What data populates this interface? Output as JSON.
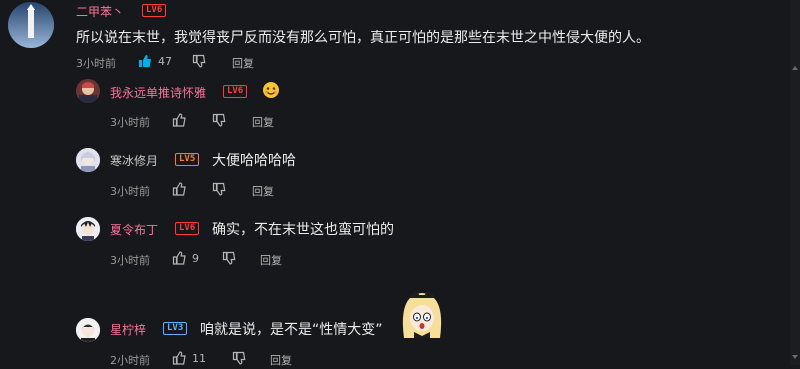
{
  "colors": {
    "background": "#17181c",
    "name_pink": "#fb7299",
    "name_gray": "#c9c9c9",
    "like_active": "#00aeec",
    "lv6": "#ff3b3b",
    "lv5": "#ff7a3a",
    "lv3": "#5fb0ff"
  },
  "main_comment": {
    "username": "二甲苯丶",
    "level": "LV6",
    "text": "所以说在末世，我觉得丧尸反而没有那么可怕，真正可怕的是那些在末世之中性侵大便的人。",
    "time": "3小时前",
    "likes": "47",
    "reply_label": "回复",
    "like_icon": "thumb-up-filled-icon",
    "dislike_icon": "thumb-down-icon"
  },
  "replies": [
    {
      "username": "我永远单推诗怀雅",
      "level": "LV6",
      "sticker": "smiling-face-emoji",
      "time": "3小时前",
      "reply_label": "回复"
    },
    {
      "username": "寒冰修月",
      "level": "LV5",
      "text": "大便哈哈哈哈",
      "time": "3小时前",
      "reply_label": "回复"
    },
    {
      "username": "夏令布丁",
      "level": "LV6",
      "text": "确实，不在末世这也蛮可怕的",
      "time": "3小时前",
      "likes": "9",
      "reply_label": "回复"
    },
    {
      "username": "星柠梓",
      "level": "LV3",
      "text": "咱就是说，是不是“性情大变”",
      "sticker": "anime-girl-shocked-sticker",
      "time": "2小时前",
      "likes": "11",
      "reply_label": "回复"
    }
  ]
}
